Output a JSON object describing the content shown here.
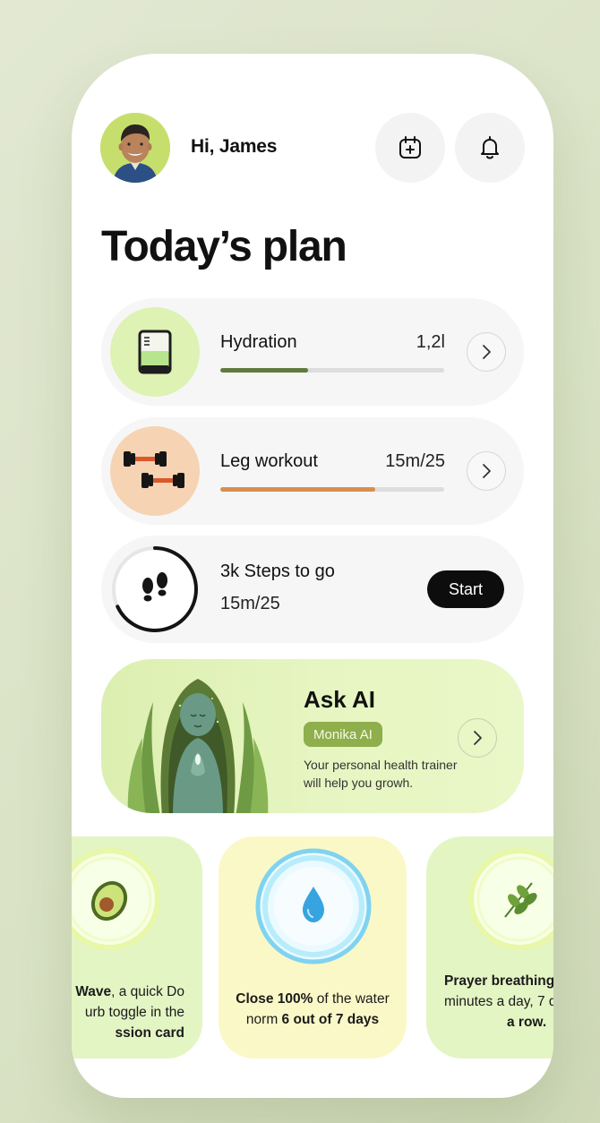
{
  "header": {
    "greeting": "Hi, James",
    "avatar_icon": "person-avatar",
    "calendar_icon": "calendar-add-icon",
    "bell_icon": "bell-icon"
  },
  "page_title": "Today’s plan",
  "plan": {
    "hydration": {
      "label": "Hydration",
      "value": "1,2l",
      "progress": 0.39,
      "color": "#5f7a3e",
      "icon": "water-glass-icon"
    },
    "leg_workout": {
      "label": "Leg workout",
      "value": "15m/25",
      "progress": 0.69,
      "color": "#d88e4f",
      "icon": "dumbbell-icon"
    },
    "steps": {
      "title": "3k Steps to go",
      "sub": "15m/25",
      "button": "Start",
      "progress": 0.68,
      "icon": "footprints-icon"
    }
  },
  "ask_ai": {
    "title": "Ask AI",
    "badge": "Monika AI",
    "description": "Your personal health trainer will help you growh."
  },
  "tiles": [
    {
      "icon": "avocado-icon",
      "bold1": "Wave",
      "text1": ", a quick Do",
      "line2": "urb toggle in the",
      "bold2": "ssion card"
    },
    {
      "icon": "water-drop-icon",
      "bold1": "Close 100%",
      "text1": " of the water",
      "text2": "norm ",
      "bold2": "6 out of 7 days"
    },
    {
      "icon": "leaf-icon",
      "bold1": "Prayer breathing",
      "line2": "minutes a day, 7 d",
      "bold2": "a row."
    }
  ],
  "colors": {
    "hydration_bg": "#def2b4",
    "workout_bg": "#f6d3b2",
    "ai_badge": "#8fae4c"
  }
}
